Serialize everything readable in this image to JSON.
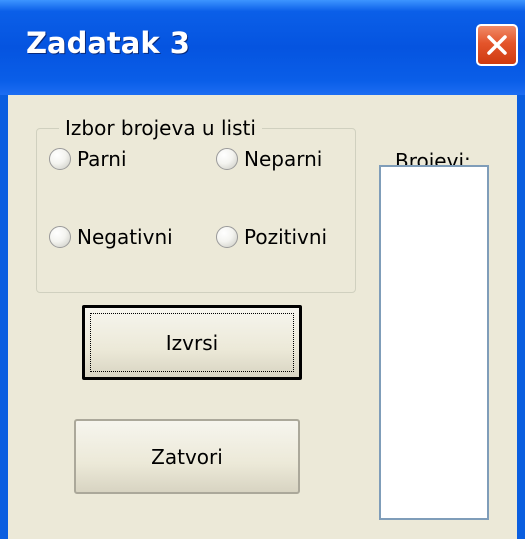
{
  "window": {
    "title": "Zadatak 3",
    "close_icon": "close-icon",
    "colors": {
      "titlebar": "#0554e0",
      "client_background": "#ece9d8",
      "close_button": "#e4552b"
    }
  },
  "group": {
    "legend": "Izbor brojeva u listi",
    "options": [
      {
        "label": "Parni",
        "selected": false
      },
      {
        "label": "Neparni",
        "selected": false
      },
      {
        "label": "Negativni",
        "selected": false
      },
      {
        "label": "Pozitivni",
        "selected": false
      }
    ]
  },
  "list": {
    "label": "Brojevi:",
    "items": []
  },
  "buttons": {
    "execute": "Izvrsi",
    "close": "Zatvori"
  }
}
